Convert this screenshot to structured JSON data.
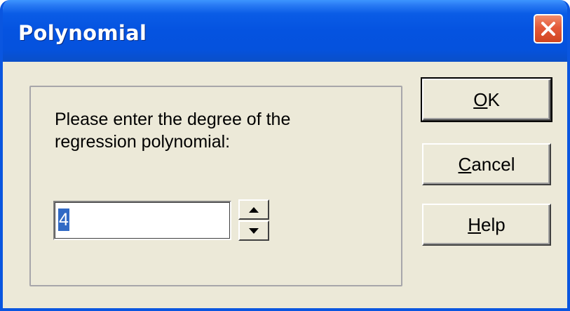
{
  "window": {
    "title": "Polynomial",
    "close_icon": "close-x-icon"
  },
  "colors": {
    "titlebar": "#0553e0",
    "dialog_background": "#ece9d8",
    "close_button": "#e45a3a",
    "selection": "#316ac5"
  },
  "prompt": {
    "line1": "Please enter the degree of the",
    "line2": "regression polynomial:"
  },
  "degree_input": {
    "value": "4",
    "up_icon": "spin-up-icon",
    "down_icon": "spin-down-icon"
  },
  "buttons": {
    "ok": {
      "mnemonic": "O",
      "rest": "K"
    },
    "cancel": {
      "mnemonic": "C",
      "rest": "ancel"
    },
    "help": {
      "mnemonic": "H",
      "rest": "elp"
    }
  }
}
